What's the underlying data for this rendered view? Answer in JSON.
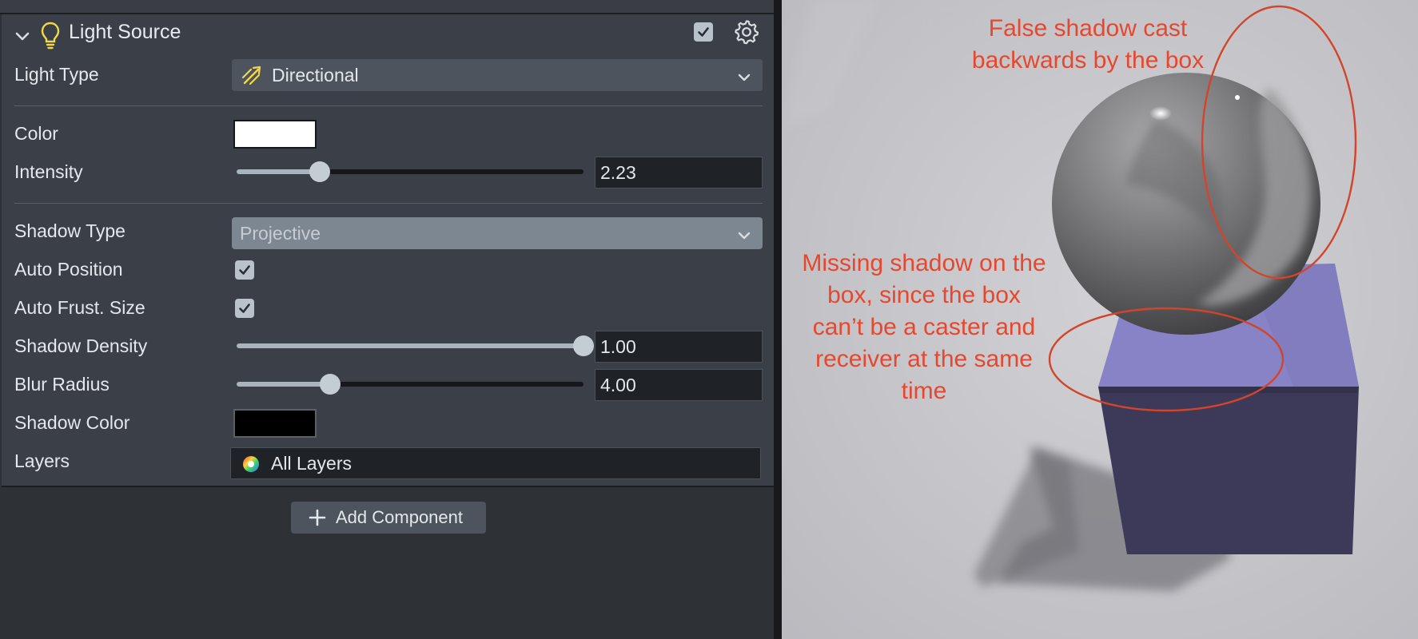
{
  "inspector": {
    "component_title": "Light Source",
    "component_enabled": true,
    "fields": {
      "light_type": {
        "label": "Light Type",
        "value": "Directional"
      },
      "color": {
        "label": "Color",
        "value": "#ffffff"
      },
      "intensity": {
        "label": "Intensity",
        "value": "2.23",
        "slider_fraction": 0.24
      },
      "shadow_type": {
        "label": "Shadow Type",
        "value": "Projective"
      },
      "auto_position": {
        "label": "Auto Position",
        "checked": true
      },
      "auto_frust_size": {
        "label": "Auto Frust. Size",
        "checked": true
      },
      "shadow_density": {
        "label": "Shadow Density",
        "value": "1.00",
        "slider_fraction": 1.0
      },
      "blur_radius": {
        "label": "Blur Radius",
        "value": "4.00",
        "slider_fraction": 0.27
      },
      "shadow_color": {
        "label": "Shadow Color",
        "value": "#000000"
      },
      "layers": {
        "label": "Layers",
        "value": "All Layers"
      }
    },
    "add_component_label": "Add Component"
  },
  "viewport": {
    "annotation_top": [
      "False shadow cast",
      "backwards by the box"
    ],
    "annotation_left": [
      "Missing shadow on the",
      "box, since the box",
      "can’t be a caster and",
      "receiver at the same",
      "time"
    ],
    "annotation_color": "#e5482e",
    "box_top_color": "#8883c6",
    "box_front_color": "#3d3a59"
  },
  "colors": {
    "panel_bg": "#3b4048",
    "icon_yellow": "#f1d84a"
  }
}
